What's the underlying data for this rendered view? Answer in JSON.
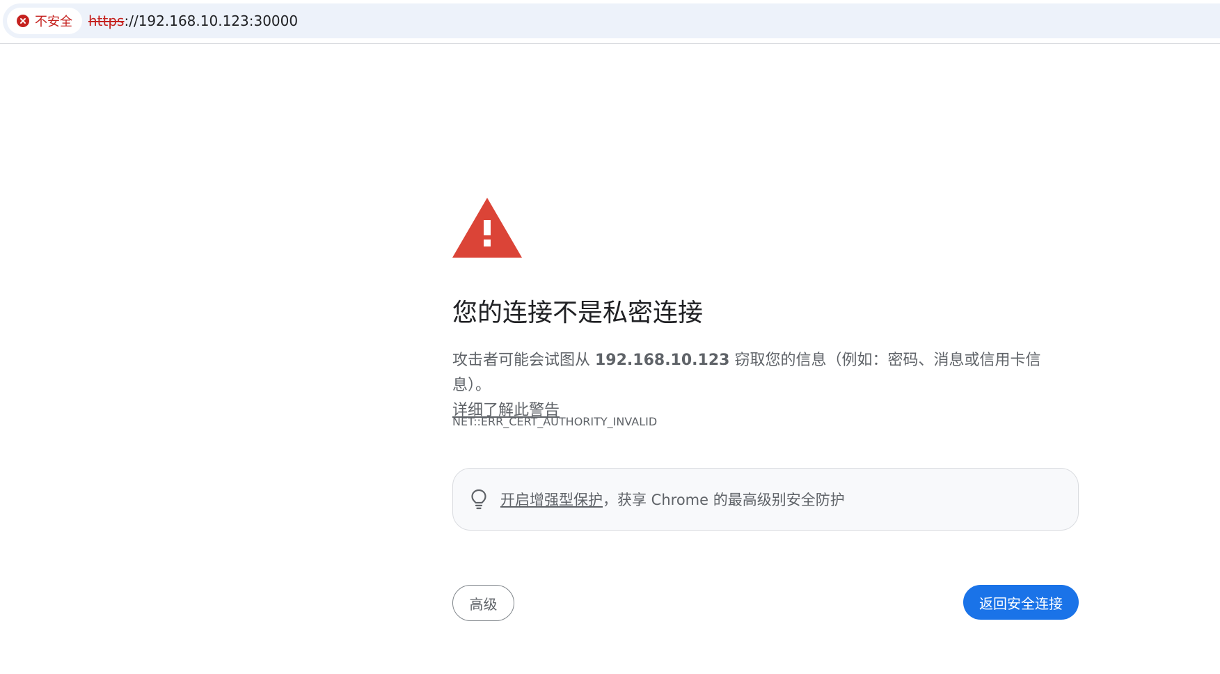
{
  "address_bar": {
    "security_label": "不安全",
    "url_scheme": "https",
    "url_rest": "://192.168.10.123:30000"
  },
  "interstitial": {
    "title": "您的连接不是私密连接",
    "explanation_before": "攻击者可能会试图从 ",
    "host": "192.168.10.123",
    "explanation_after": " 窃取您的信息（例如：密码、消息或信用卡信息）。",
    "learn_more": "详细了解此警告",
    "error_code": "NET::ERR_CERT_AUTHORITY_INVALID",
    "enhanced_link": "开启增强型保护",
    "enhanced_text": "，获享 Chrome 的最高级别安全防护",
    "advanced_button": "高级",
    "back_button": "返回安全连接"
  },
  "icons": {
    "security": "error-circle-icon",
    "warning": "warning-triangle-icon",
    "enhanced": "lightbulb-icon"
  },
  "colors": {
    "danger": "#c5221f",
    "warning_icon": "#db4437",
    "primary_button": "#1a73e8",
    "text_secondary": "#5f6368"
  }
}
